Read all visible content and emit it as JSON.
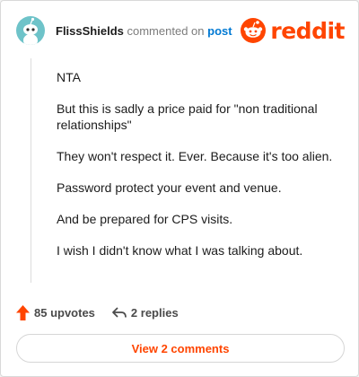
{
  "header": {
    "username": "FlissShields",
    "action_text": "commented on",
    "post_link_text": "post",
    "logo_text": "reddit",
    "avatar_icon": "snoo-avatar-icon",
    "logo_icon": "reddit-snoo-icon"
  },
  "comment": {
    "paragraphs": [
      "NTA",
      "But this is sadly a price paid for \"non traditional relationships\"",
      "They won't respect it. Ever. Because it's too alien.",
      "Password protect your event and venue.",
      "And be prepared for CPS visits.",
      "I wish I didn't know what I was talking about."
    ]
  },
  "footer": {
    "upvotes_label": "85 upvotes",
    "replies_label": "2 replies",
    "upvote_icon": "upvote-arrow-icon",
    "reply_icon": "reply-arrow-icon"
  },
  "view_comments_label": "View 2 comments",
  "colors": {
    "brand": "#ff4500",
    "link": "#0079d3",
    "avatar_bg": "#6ec3c9"
  }
}
